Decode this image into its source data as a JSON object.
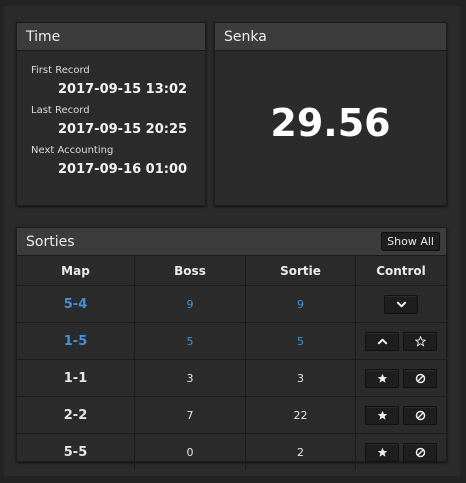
{
  "time": {
    "title": "Time",
    "first_record_label": "First Record",
    "first_record_value": "2017-09-15 13:02",
    "last_record_label": "Last Record",
    "last_record_value": "2017-09-15 20:25",
    "next_accounting_label": "Next Accounting",
    "next_accounting_value": "2017-09-16 01:00"
  },
  "senka": {
    "title": "Senka",
    "value": "29.56"
  },
  "sorties": {
    "title": "Sorties",
    "show_all_label": "Show All",
    "columns": [
      "Map",
      "Boss",
      "Sortie",
      "Control"
    ],
    "rows": [
      {
        "map": "5-4",
        "boss": "9",
        "sortie": "9",
        "highlight": true,
        "controls": [
          "chevron-down-icon"
        ]
      },
      {
        "map": "1-5",
        "boss": "5",
        "sortie": "5",
        "highlight": true,
        "controls": [
          "chevron-up-icon",
          "star-outline-icon"
        ]
      },
      {
        "map": "1-1",
        "boss": "3",
        "sortie": "3",
        "highlight": false,
        "controls": [
          "star-icon",
          "ban-icon"
        ]
      },
      {
        "map": "2-2",
        "boss": "7",
        "sortie": "22",
        "highlight": false,
        "controls": [
          "star-icon",
          "ban-icon"
        ]
      },
      {
        "map": "5-5",
        "boss": "0",
        "sortie": "2",
        "highlight": false,
        "controls": [
          "star-icon",
          "ban-icon"
        ]
      }
    ]
  },
  "colors": {
    "background": "#232323",
    "panel": "#2b2b2b",
    "panel_header": "#3c3c3c",
    "accent_blue": "#3f93d8"
  }
}
